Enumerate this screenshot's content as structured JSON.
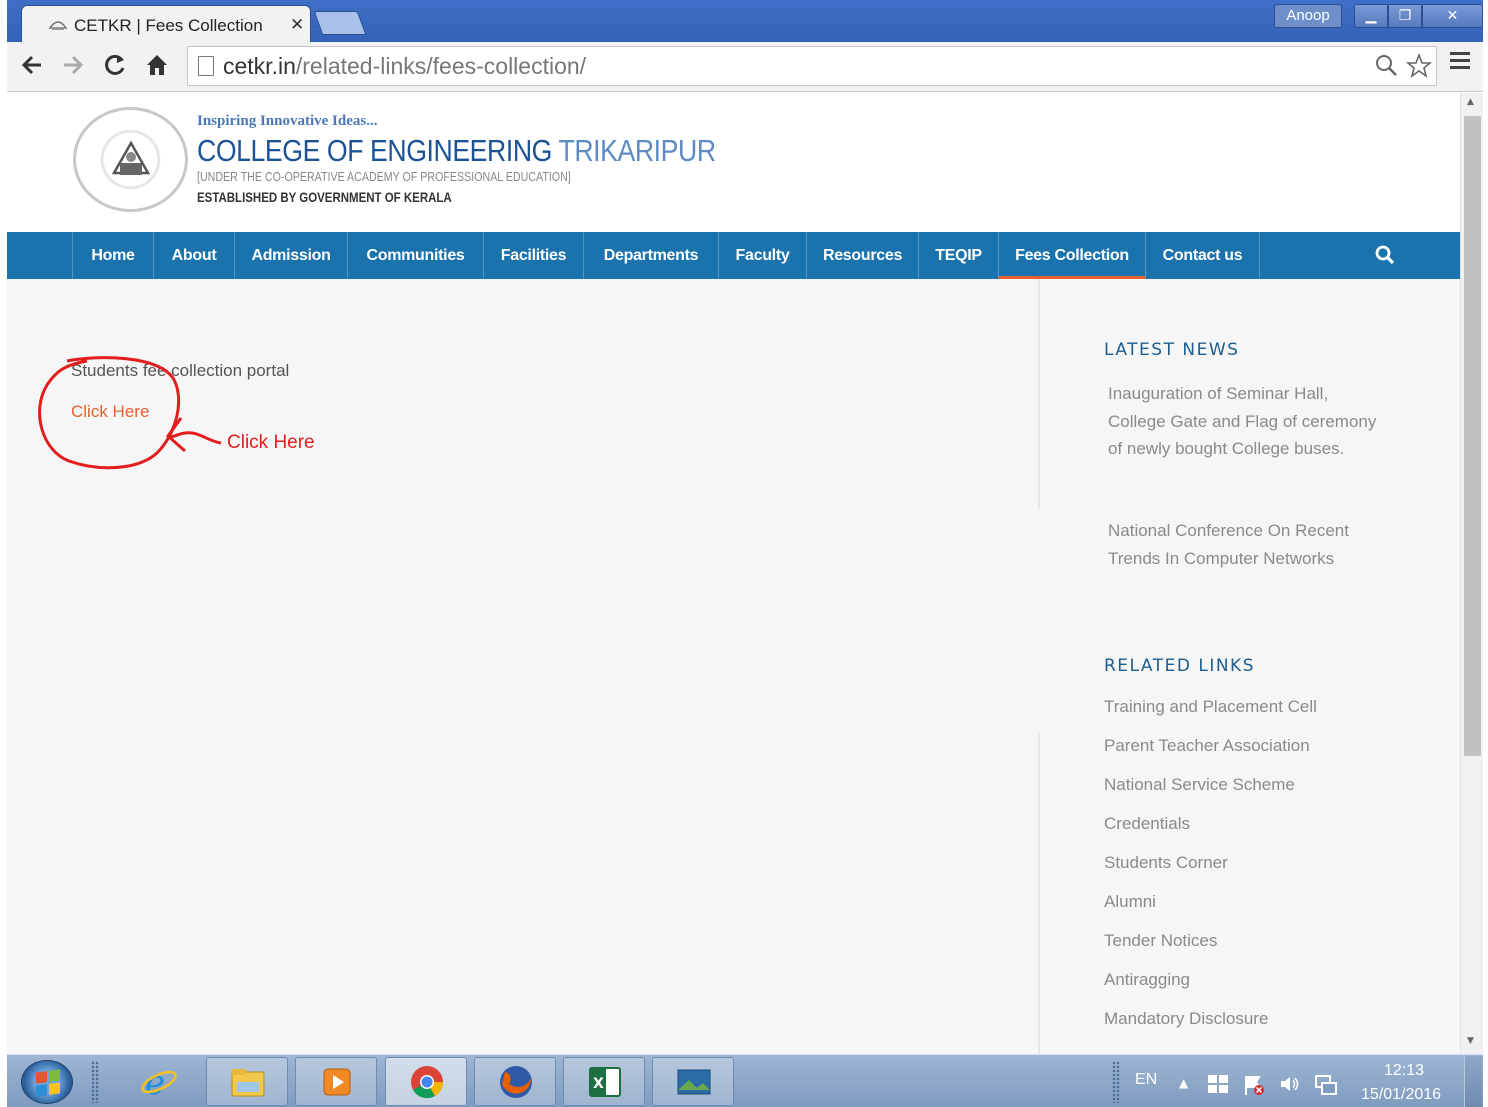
{
  "browser": {
    "tab_title": "CETKR | Fees Collection",
    "tab_close": "✕",
    "user": "Anoop",
    "url_host": "cetkr.in",
    "url_path": "/related-links/fees-collection/"
  },
  "site": {
    "tagline": "Inspiring Innovative Ideas...",
    "college_name": "COLLEGE OF ENGINEERING",
    "college_place": "TRIKARIPUR",
    "sub_line1": "[UNDER THE CO-OPERATIVE ACADEMY OF PROFESSIONAL EDUCATION]",
    "sub_line2": "ESTABLISHED BY GOVERNMENT OF KERALA"
  },
  "nav": {
    "items": [
      {
        "label": "Home"
      },
      {
        "label": "About"
      },
      {
        "label": "Admission"
      },
      {
        "label": "Communities"
      },
      {
        "label": "Facilities"
      },
      {
        "label": "Departments"
      },
      {
        "label": "Faculty"
      },
      {
        "label": "Resources"
      },
      {
        "label": "TEQIP"
      },
      {
        "label": "Fees Collection",
        "active": true
      },
      {
        "label": "Contact us"
      }
    ]
  },
  "main": {
    "portal_text": "Students fee collection portal",
    "portal_link": "Click Here",
    "annotation_text": "Click Here",
    "annotation_color": "#e21d1d"
  },
  "sidebar": {
    "latest_news_heading": "LATEST NEWS",
    "news": [
      [
        "Inauguration of Seminar Hall,",
        "College Gate and Flag of ceremony",
        "of newly bought College buses."
      ],
      [
        "National Conference On Recent",
        "Trends In Computer Networks"
      ]
    ],
    "related_links_heading": "RELATED LINKS",
    "related_links": [
      "Training and Placement Cell",
      "Parent Teacher Association",
      "National Service Scheme",
      "Credentials",
      "Students Corner",
      "Alumni",
      "Tender Notices",
      "Antiragging",
      "Mandatory Disclosure"
    ]
  },
  "taskbar": {
    "language": "EN",
    "time": "12:13",
    "date": "15/01/2016",
    "apps": [
      "internet-explorer",
      "file-explorer",
      "media-player",
      "chrome",
      "firefox",
      "excel",
      "picture-viewer"
    ]
  },
  "colors": {
    "nav_bg": "#1a73ad",
    "accent_orange": "#e2612f",
    "heading_blue": "#1b5e8f"
  }
}
